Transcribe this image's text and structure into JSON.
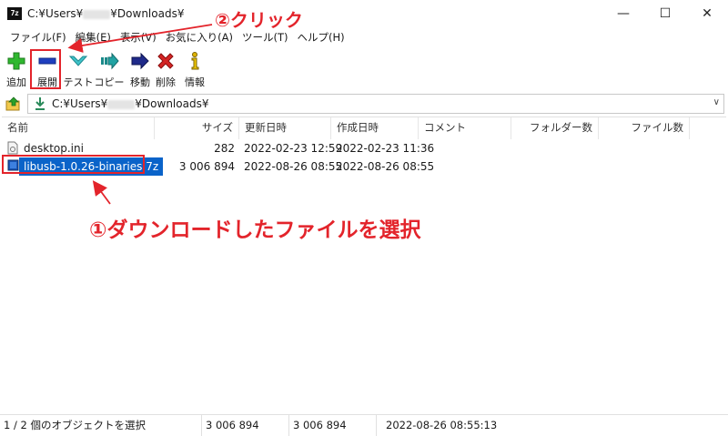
{
  "window": {
    "app_icon_text": "7z",
    "title_prefix": "C:¥Users¥",
    "title_suffix": "¥Downloads¥",
    "minimize_glyph": "—",
    "maximize_glyph": "☐",
    "close_glyph": "✕"
  },
  "menu": [
    "ファイル(F)",
    "編集(E)",
    "表示(V)",
    "お気に入り(A)",
    "ツール(T)",
    "ヘルプ(H)"
  ],
  "toolbar": {
    "add": "追加",
    "extract": "展開",
    "test": "テスト",
    "copy": "コピー",
    "move": "移動",
    "delete": "削除",
    "info": "情報"
  },
  "address": {
    "prefix": "C:¥Users¥",
    "suffix": "¥Downloads¥",
    "dropdown_glyph": "∨"
  },
  "columns": {
    "name": "名前",
    "size": "サイズ",
    "modified": "更新日時",
    "created": "作成日時",
    "comment": "コメント",
    "folders": "フォルダー数",
    "files": "ファイル数"
  },
  "rows": [
    {
      "name": "desktop.ini",
      "size": "282",
      "modified": "2022-02-23 12:59",
      "created": "2022-02-23 11:36"
    },
    {
      "name": "libusb-1.0.26-binaries.7z",
      "size": "3 006 894",
      "modified": "2022-08-26 08:55",
      "created": "2022-08-26 08:55"
    }
  ],
  "status": {
    "selection": "1 / 2 個のオブジェクトを選択",
    "size_a": "3 006 894",
    "size_b": "3 006 894",
    "datetime": "2022-08-26 08:55:13"
  },
  "annotations": {
    "step1": "①ダウンロードしたファイルを選択",
    "step2": "②クリック"
  },
  "colors": {
    "annotation_red": "#e3242b",
    "selection_blue": "#0a63c9"
  }
}
